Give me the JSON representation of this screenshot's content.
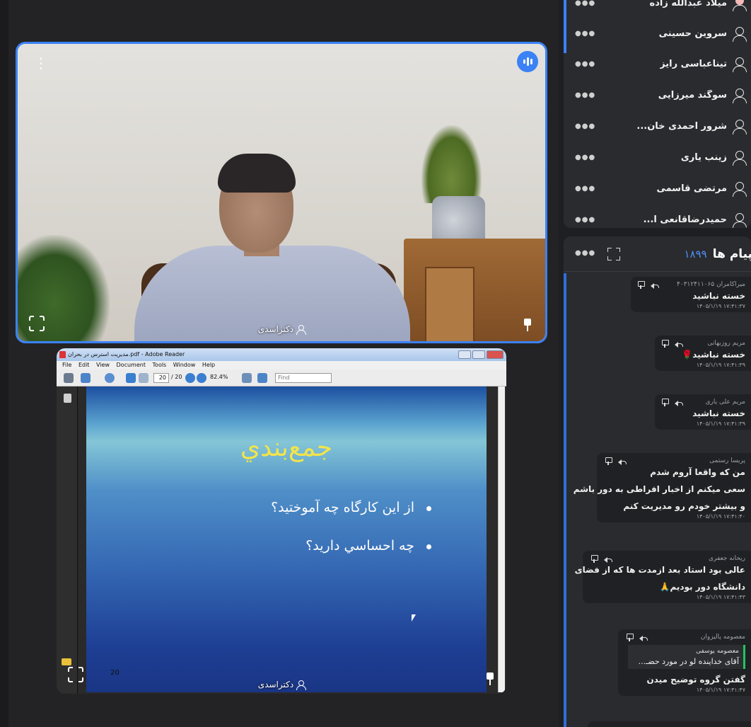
{
  "stage": {
    "camera_tile": {
      "participant_name": "دکتراسدی",
      "accent": "#3b82f6"
    },
    "share_tile": {
      "participant_name": "دکتراسدی",
      "window_title": "مدیریت استرس در بحران.pdf - Adobe Reader",
      "menu": [
        "File",
        "Edit",
        "View",
        "Document",
        "Tools",
        "Window",
        "Help"
      ],
      "page_current": "20",
      "page_total": "/ 20",
      "zoom": "82.4%",
      "find_placeholder": "Find",
      "slide": {
        "title": "جمع‌بندي",
        "bullets": [
          "از اين كارگاه چه آموختيد؟",
          "چه احساسي داريد؟"
        ],
        "page_number": "20"
      }
    }
  },
  "participants": [
    {
      "name": "میلاد عبدالله زاده"
    },
    {
      "name": "سروین حسینی"
    },
    {
      "name": "تیناعباسی رایز"
    },
    {
      "name": "سوگند میرزایی"
    },
    {
      "name": "شرور احمدی خان..."
    },
    {
      "name": "زینب یاری"
    },
    {
      "name": "مرتضی قاسمی"
    },
    {
      "name": "حمیدرضاقانعی ا..."
    }
  ],
  "chat": {
    "title": "پیام ها",
    "count": "۱۸۹۹",
    "messages": [
      {
        "sender": "میراکامران ۴۰۳۱۲۴۱۱۰۶۵",
        "lines": [
          "خسته نباشید"
        ],
        "time": "۱۴۰۵/۱/۱۹ ۱۷:۴۱:۳۷"
      },
      {
        "sender": "مریم روزبهانی",
        "lines": [
          "خسته نباشید🌹"
        ],
        "time": "۱۴۰۵/۱/۱۹ ۱۷:۴۱:۳۹"
      },
      {
        "sender": "مریم علی یاری",
        "lines": [
          "خسته نباشید"
        ],
        "time": "۱۴۰۵/۱/۱۹ ۱۷:۴۱:۳۹"
      },
      {
        "sender": "پریسا رستمی",
        "lines": [
          "من که واقعا آروم شدم",
          "سعی میکنم از اخبار افراطی به دور باشم",
          "و بیشتر خودم رو مدیریت کنم"
        ],
        "time": "۱۴۰۵/۱/۱۹ ۱۷:۴۱:۴۰"
      },
      {
        "sender": "ریحانه جعفری",
        "lines": [
          "عالی بود استاد بعد ازمدت ها که از فضای",
          "دانشگاه دور بودیم🙏"
        ],
        "time": "۱۴۰۵/۱/۱۹ ۱۷:۴۱:۴۳"
      },
      {
        "sender": "معصومه پالیزوان",
        "quote_name": "معصومه یوسفی",
        "quote_text": "آقای خداینده لو در مورد حضـ...",
        "lines": [
          "گفتن گروه توضیح میدن"
        ],
        "time": "۱۴۰۵/۱/۱۹ ۱۷:۴۱:۴۷"
      }
    ]
  }
}
